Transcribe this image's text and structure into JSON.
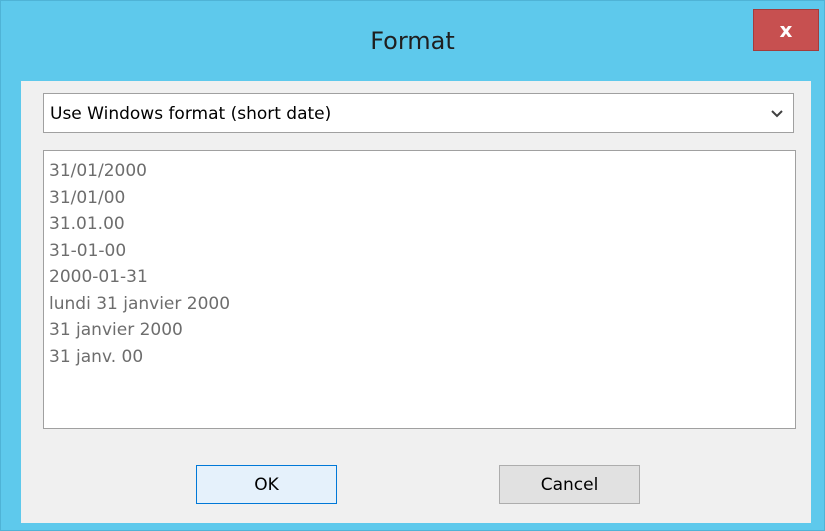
{
  "window": {
    "title": "Format",
    "close_label": "x"
  },
  "format_dropdown": {
    "selected": "Use Windows format (short date)",
    "icon": "chevron-down-icon"
  },
  "format_list": {
    "items": [
      "31/01/2000",
      "31/01/00",
      "31.01.00",
      "31-01-00",
      "2000-01-31",
      "lundi 31 janvier 2000",
      "31 janvier 2000",
      "31 janv. 00"
    ]
  },
  "buttons": {
    "ok_label": "OK",
    "cancel_label": "Cancel"
  },
  "colors": {
    "titlebar": "#5ec9ec",
    "close_button": "#c75050",
    "client_background": "#f0f0f0",
    "list_text": "#6d6d6d"
  }
}
